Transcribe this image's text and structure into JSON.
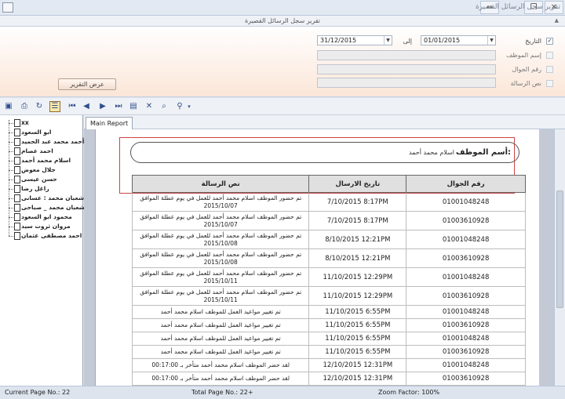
{
  "window": {
    "title": "تقرير سجل الرسائل القصيرة"
  },
  "header": {
    "title": "تقرير سجل الرسائل القصيرة"
  },
  "filters": {
    "date": {
      "label": "التاريخ",
      "checked": true,
      "from": "01/01/2015",
      "to_label": "إلى",
      "to": "31/12/2015"
    },
    "employee": {
      "label": "إسم الموظف"
    },
    "mobile": {
      "label": "رقم الجوال"
    },
    "message": {
      "label": "نص الرسالة"
    },
    "report_button": "عرض التقرير"
  },
  "tree": {
    "items": [
      "xx",
      "ابو السعود",
      "أحمد محمد عبد الحميد",
      "احمد عصام",
      "اسلام محمد أحمد",
      "جلال معوض",
      "حسن عيسى",
      "راغل رضا",
      "شعبان محمد : عسانى",
      "شعبان محمد _ صباحى",
      "محمود ابو السعود",
      "مروان ثروت سيد",
      "ى احمد مصطفى عثمان"
    ]
  },
  "tabs": [
    {
      "label": "Main Report"
    }
  ],
  "report": {
    "employee_label": "أسم الموظف:",
    "employee_name": "اسلام محمد أحمد",
    "columns": {
      "mobile": "رقم الجوال",
      "date": "تاريخ الارسال",
      "message": "نص الرسالة"
    },
    "rows": [
      {
        "mobile": "01001048248",
        "date": "7/10/2015   8:17PM",
        "message": "تم حضور الموظف اسلام محمد أحمد للعمل في يوم عطلة الموافق 2015/10/07"
      },
      {
        "mobile": "01003610928",
        "date": "7/10/2015   8:17PM",
        "message": "تم حضور الموظف اسلام محمد أحمد للعمل في يوم عطلة الموافق 2015/10/07"
      },
      {
        "mobile": "01001048248",
        "date": "8/10/2015   12:21PM",
        "message": "تم حضور الموظف اسلام محمد أحمد للعمل في يوم عطلة الموافق 2015/10/08"
      },
      {
        "mobile": "01003610928",
        "date": "8/10/2015   12:21PM",
        "message": "تم حضور الموظف اسلام محمد أحمد للعمل في يوم عطلة الموافق 2015/10/08"
      },
      {
        "mobile": "01001048248",
        "date": "11/10/2015   12:29PM",
        "message": "تم حضور الموظف اسلام محمد أحمد للعمل في يوم عطلة الموافق 2015/10/11"
      },
      {
        "mobile": "01003610928",
        "date": "11/10/2015   12:29PM",
        "message": "تم حضور الموظف اسلام محمد أحمد للعمل في يوم عطلة الموافق 2015/10/11"
      },
      {
        "mobile": "01001048248",
        "date": "11/10/2015   6:55PM",
        "message": "تم تغيير مواعيد العمل للموظف اسلام محمد أحمد"
      },
      {
        "mobile": "01003610928",
        "date": "11/10/2015   6:55PM",
        "message": "تم تغيير مواعيد العمل للموظف اسلام محمد أحمد"
      },
      {
        "mobile": "01001048248",
        "date": "11/10/2015   6:55PM",
        "message": "تم تغيير مواعيد العمل للموظف اسلام محمد أحمد"
      },
      {
        "mobile": "01003610928",
        "date": "11/10/2015   6:55PM",
        "message": "تم تغيير مواعيد العمل للموظف اسلام محمد أحمد"
      },
      {
        "mobile": "01001048248",
        "date": "12/10/2015   12:31PM",
        "message": "لقد حضر الموظف  اسلام محمد أحمد متأخر بـ 00:17:00"
      },
      {
        "mobile": "01003610928",
        "date": "12/10/2015   12:31PM",
        "message": "لقد حضر الموظف  اسلام محمد أحمد متأخر بـ 00:17:00"
      }
    ]
  },
  "status": {
    "current_page": "Current Page No.: 22",
    "total_page": "Total Page No.: 22+",
    "zoom": "Zoom Factor: 100%"
  },
  "icons": {
    "window": "window-icon",
    "nav": [
      "first-page-icon",
      "prev-page-icon",
      "next-page-icon",
      "last-page-icon"
    ]
  }
}
